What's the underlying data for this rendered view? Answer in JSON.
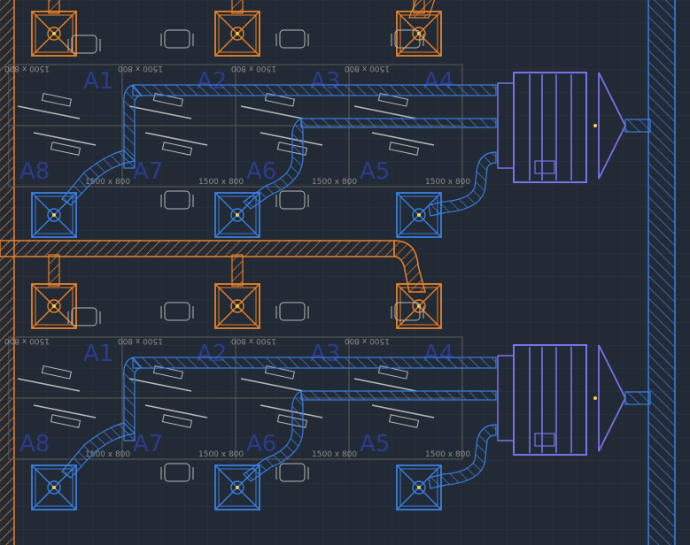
{
  "colors": {
    "background": "#222a35",
    "grid": "#2b3440",
    "supply_duct": "#e8822a",
    "return_duct": "#3a7fe0",
    "desk_outline": "#b8b8b8",
    "label": "#2d3b8c",
    "ahu": "#7a72e8",
    "wall_hatch": "#3a7fe0"
  },
  "groups": [
    {
      "desks": [
        {
          "label": "A1",
          "dim": "1500 x 800"
        },
        {
          "label": "A2",
          "dim": "1500 x 800"
        },
        {
          "label": "A3",
          "dim": "1500 x 800"
        },
        {
          "label": "A4",
          "dim": "1500 x 800"
        },
        {
          "label": "A8",
          "dim": "1500 x 800"
        },
        {
          "label": "A7",
          "dim": "1500 x 800"
        },
        {
          "label": "A6",
          "dim": "1500 x 800"
        },
        {
          "label": "A5",
          "dim": "1500 x 800"
        }
      ]
    },
    {
      "desks": [
        {
          "label": "A1",
          "dim": "1500 x 800"
        },
        {
          "label": "A2",
          "dim": "1500 x 800"
        },
        {
          "label": "A3",
          "dim": "1500 x 800"
        },
        {
          "label": "A4",
          "dim": "1500 x 800"
        },
        {
          "label": "A8",
          "dim": "1500 x 800"
        },
        {
          "label": "A7",
          "dim": "1500 x 800"
        },
        {
          "label": "A6",
          "dim": "1500 x 800"
        },
        {
          "label": "A5",
          "dim": "1500 x 800"
        }
      ]
    }
  ]
}
